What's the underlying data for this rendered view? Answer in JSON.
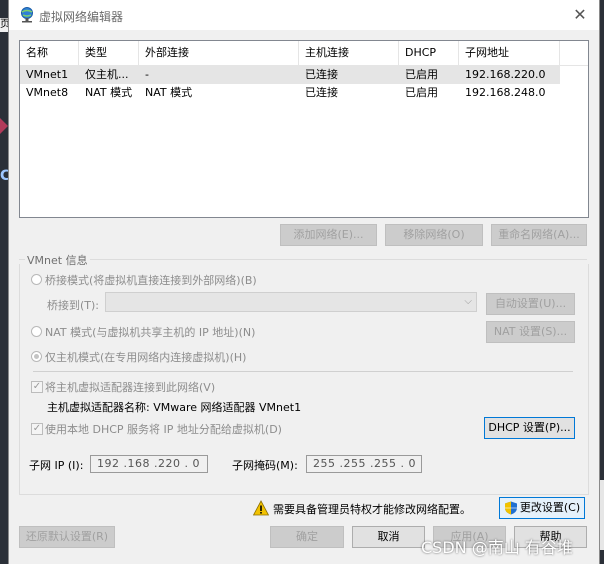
{
  "window": {
    "title": "虚拟网络编辑器"
  },
  "background": {
    "left_fragment": "页",
    "left_fragment2": "C"
  },
  "table": {
    "headers": [
      "名称",
      "类型",
      "外部连接",
      "主机连接",
      "DHCP",
      "子网地址"
    ],
    "rows": [
      [
        "VMnet1",
        "仅主机...",
        "-",
        "已连接",
        "已启用",
        "192.168.220.0"
      ],
      [
        "VMnet8",
        "NAT 模式",
        "NAT 模式",
        "已连接",
        "已启用",
        "192.168.248.0"
      ]
    ]
  },
  "list_buttons": {
    "add": "添加网络(E)...",
    "remove": "移除网络(O)",
    "rename": "重命名网络(A)..."
  },
  "vmnet_info": {
    "group_title": "VMnet 信息",
    "bridge_label": "桥接模式(将虚拟机直接连接到外部网络)(B)",
    "bridge_to_label": "桥接到(T):",
    "bridge_to_value": "",
    "auto_settings": "自动设置(U)...",
    "nat_label": "NAT 模式(与虚拟机共享主机的 IP 地址)(N)",
    "nat_settings": "NAT 设置(S)...",
    "host_only_label": "仅主机模式(在专用网络内连接虚拟机)(H)",
    "connect_adapter_label": "将主机虚拟适配器连接到此网络(V)",
    "adapter_name_label": "主机虚拟适配器名称: VMware 网络适配器 VMnet1",
    "dhcp_label": "使用本地 DHCP 服务将 IP 地址分配给虚拟机(D)",
    "dhcp_settings": "DHCP 设置(P)...",
    "subnet_ip_label": "子网 IP (I):",
    "subnet_ip_value": "192 .168 .220 . 0",
    "subnet_mask_label": "子网掩码(M):",
    "subnet_mask_value": "255 .255 .255 . 0"
  },
  "admin_notice": {
    "text": "需要具备管理员特权才能修改网络配置。",
    "change_settings": "更改设置(C)"
  },
  "footer": {
    "restore_defaults": "还原默认设置(R)",
    "ok": "确定",
    "cancel": "取消",
    "apply": "应用(A)",
    "help": "帮助"
  },
  "watermark": "CSDN @南山 有谷堆",
  "colors": {
    "accent": "#0078d7",
    "warning": "#f2c200"
  }
}
